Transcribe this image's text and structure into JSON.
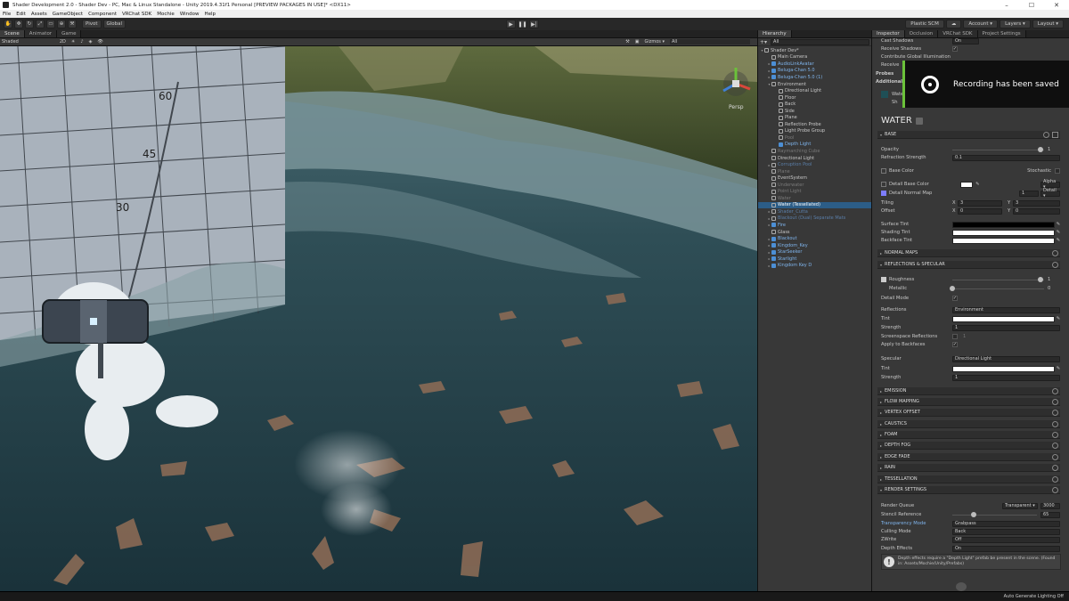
{
  "window": {
    "title": "Shader Development 2.0 - Shader Dev - PC, Mac & Linux Standalone - Unity 2019.4.31f1 Personal [PREVIEW PACKAGES IN USE]* <DX11>",
    "controls": [
      "–",
      "☐",
      "✕"
    ]
  },
  "menu": [
    "File",
    "Edit",
    "Assets",
    "GameObject",
    "Component",
    "VRChat SDK",
    "Mochie",
    "Window",
    "Help"
  ],
  "toolbar": {
    "pivot": "Pivot",
    "global": "Global",
    "plastic": "Plastic SCM",
    "account": "Account ▾",
    "layers": "Layers ▾",
    "layout": "Layout ▾"
  },
  "scene": {
    "tabs": [
      "Scene",
      "Animator",
      "Game"
    ],
    "shading": "Shaded",
    "mode": "2D",
    "gizmos": "Gizmos ▾",
    "search": "All",
    "persp": "Persp",
    "labels": [
      "60",
      "45",
      "30"
    ]
  },
  "hierarchy": {
    "tab": "Hierarchy",
    "search": "All",
    "items": [
      {
        "label": "Shader Dev*",
        "depth": 0,
        "arrow": "▾",
        "icon": "unity-scene-icon"
      },
      {
        "label": "Main Camera",
        "depth": 1,
        "arrow": "",
        "icon": "gameobject-icon"
      },
      {
        "label": "AudioLinkAvatar",
        "depth": 1,
        "arrow": "▸",
        "icon": "prefab-icon",
        "link": true
      },
      {
        "label": "Beluga-Chan 5.0",
        "depth": 1,
        "arrow": "▸",
        "icon": "prefab-icon",
        "link": true
      },
      {
        "label": "Beluga-Chan 5.0 (1)",
        "depth": 1,
        "arrow": "▸",
        "icon": "prefab-icon",
        "link": true
      },
      {
        "label": "Environment",
        "depth": 1,
        "arrow": "▾",
        "icon": "gameobject-icon"
      },
      {
        "label": "Directional Light",
        "depth": 2,
        "arrow": "",
        "icon": "gameobject-icon"
      },
      {
        "label": "Floor",
        "depth": 2,
        "arrow": "",
        "icon": "gameobject-icon"
      },
      {
        "label": "Back",
        "depth": 2,
        "arrow": "",
        "icon": "gameobject-icon"
      },
      {
        "label": "Side",
        "depth": 2,
        "arrow": "",
        "icon": "gameobject-icon"
      },
      {
        "label": "Plane",
        "depth": 2,
        "arrow": "",
        "icon": "gameobject-icon"
      },
      {
        "label": "Reflection Probe",
        "depth": 2,
        "arrow": "",
        "icon": "gameobject-icon"
      },
      {
        "label": "Light Probe Group",
        "depth": 2,
        "arrow": "",
        "icon": "gameobject-icon"
      },
      {
        "label": "Pool",
        "depth": 2,
        "arrow": "",
        "icon": "gameobject-icon",
        "dim": true
      },
      {
        "label": "Depth Light",
        "depth": 2,
        "arrow": "",
        "icon": "prefab-icon",
        "link": true
      },
      {
        "label": "Raymarching Cube",
        "depth": 1,
        "arrow": "",
        "icon": "gameobject-icon",
        "dim": true
      },
      {
        "label": "Directional Light",
        "depth": 1,
        "arrow": "",
        "icon": "gameobject-icon"
      },
      {
        "label": "Corruption Pool",
        "depth": 1,
        "arrow": "▸",
        "icon": "prefab-icon",
        "dim": true
      },
      {
        "label": "Plane",
        "depth": 1,
        "arrow": "",
        "icon": "gameobject-icon",
        "dim": true
      },
      {
        "label": "EventSystem",
        "depth": 1,
        "arrow": "",
        "icon": "gameobject-icon"
      },
      {
        "label": "Underwater",
        "depth": 1,
        "arrow": "",
        "icon": "gameobject-icon",
        "dim": true
      },
      {
        "label": "Point Light",
        "depth": 1,
        "arrow": "",
        "icon": "gameobject-icon",
        "dim": true
      },
      {
        "label": "Water",
        "depth": 1,
        "arrow": "",
        "icon": "gameobject-icon",
        "dim": true
      },
      {
        "label": "Water (Tessellated)",
        "depth": 1,
        "arrow": "",
        "icon": "gameobject-icon",
        "selected": true
      },
      {
        "label": "Shader_Cutta",
        "depth": 1,
        "arrow": "▸",
        "icon": "prefab-icon",
        "dim": true
      },
      {
        "label": "Blackout (Dual) Separate Mats",
        "depth": 1,
        "arrow": "▸",
        "icon": "prefab-icon",
        "dim": true
      },
      {
        "label": "Fire",
        "depth": 1,
        "arrow": "▸",
        "icon": "prefab-icon",
        "link": true
      },
      {
        "label": "Glass",
        "depth": 1,
        "arrow": "",
        "icon": "gameobject-icon"
      },
      {
        "label": "Blackout",
        "depth": 1,
        "arrow": "▸",
        "icon": "prefab-icon",
        "link": true
      },
      {
        "label": "Kingdom_Key",
        "depth": 1,
        "arrow": "▸",
        "icon": "prefab-icon",
        "link": true
      },
      {
        "label": "StarSeeker",
        "depth": 1,
        "arrow": "▸",
        "icon": "prefab-icon",
        "link": true
      },
      {
        "label": "Starlight",
        "depth": 1,
        "arrow": "▸",
        "icon": "prefab-icon",
        "link": true
      },
      {
        "label": "Kingdom Key D",
        "depth": 1,
        "arrow": "▸",
        "icon": "prefab-icon",
        "link": true
      }
    ]
  },
  "inspector": {
    "tabs": [
      "Inspector",
      "Occlusion",
      "VRChat SDK",
      "Project Settings"
    ],
    "top_rows": [
      "Cast Shadows",
      "Receive Shadows",
      "Contribute Global Illumination",
      "Receive"
    ],
    "cast_shadows_value": "On",
    "probes": "Probes",
    "additional": "Additional",
    "material_name": "Water",
    "shader_prefix": "Sh",
    "header": "WATER",
    "sections": {
      "base": "BASE",
      "normal_maps": "NORMAL MAPS",
      "reflections": "REFLECTIONS & SPECULAR",
      "emission": "EMISSION",
      "flow": "FLOW MAPPING",
      "vertex": "VERTEX OFFSET",
      "caustics": "CAUSTICS",
      "foam": "FOAM",
      "depth_fog": "DEPTH FOG",
      "edge_fade": "EDGE FADE",
      "rain": "RAIN",
      "tessellation": "TESSELLATION",
      "render": "RENDER SETTINGS"
    },
    "base": {
      "opacity_label": "Opacity",
      "opacity": "1",
      "refraction_label": "Refraction Strength",
      "refraction": "0.1",
      "base_color_label": "Base Color",
      "stochastic_label": "Stochastic",
      "detail_base_label": "Detail Base Color",
      "detail_base_mode": "Alpha ▾",
      "detail_normal_label": "Detail Normal Map",
      "detail_normal_value": "1",
      "detail_normal_mode": "Detail ▾",
      "tiling_label": "Tiling",
      "tiling_x": "3",
      "tiling_y": "3",
      "offset_label": "Offset",
      "offset_x": "0",
      "offset_y": "0",
      "x": "X",
      "y": "Y",
      "surface_tint": "Surface Tint",
      "shading_tint": "Shading Tint",
      "backface_tint": "Backface Tint"
    },
    "refl": {
      "roughness_label": "Roughness",
      "roughness": "1",
      "metallic_label": "Metallic",
      "metallic": "0",
      "detail_mode_label": "Detail Mode",
      "reflections_label": "Reflections",
      "reflections_value": "Environment",
      "tint_label": "Tint",
      "strength_label": "Strength",
      "strength": "1",
      "ssr_label": "Screenspace Reflections",
      "ssr_value": "1",
      "apply_backfaces_label": "Apply to Backfaces",
      "specular_label": "Specular",
      "specular_value": "Directional Light",
      "spec_tint_label": "Tint",
      "spec_strength_label": "Strength",
      "spec_strength": "1"
    },
    "render": {
      "queue_label": "Render Queue",
      "queue_mode": "Transparent ▾",
      "queue_value": "3000",
      "stencil_label": "Stencil Reference",
      "stencil_value": "65",
      "transparency_label": "Transparency Mode",
      "transparency_value": "Grabpass",
      "culling_label": "Culling Mode",
      "culling_value": "Back",
      "zwrite_label": "ZWrite",
      "zwrite_value": "Off",
      "depth_label": "Depth Effects",
      "depth_value": "On",
      "info": "Depth effects require a \"Depth Light\" prefab be present in the scene. (Found in: Assets/Mochie/Unity/Prefabs)"
    }
  },
  "toast": {
    "text": "Recording has been saved"
  },
  "status": {
    "text": "Auto Generate Lighting Off"
  }
}
